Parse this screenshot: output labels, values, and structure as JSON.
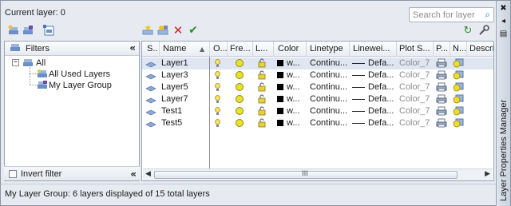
{
  "window": {
    "title": "Layer Properties Manager"
  },
  "current_layer": "Current layer: 0",
  "search": {
    "placeholder": "Search for layer"
  },
  "filters": {
    "header": "Filters",
    "tree": [
      {
        "label": "All"
      },
      {
        "label": "All Used Layers"
      },
      {
        "label": "My Layer Group"
      }
    ],
    "invert_label": "Invert filter"
  },
  "grid": {
    "columns": [
      "S..",
      "Name",
      "O...",
      "Fre...",
      "L...",
      "Color",
      "Linetype",
      "Linewei...",
      "Plot S...",
      "P...",
      "N...",
      "Descrip"
    ],
    "rows": [
      {
        "name": "Layer1",
        "color": "w...",
        "linetype": "Continu...",
        "lineweight": "Defa...",
        "plot_style": "Color_7"
      },
      {
        "name": "Layer3",
        "color": "w...",
        "linetype": "Continu...",
        "lineweight": "Defa...",
        "plot_style": "Color_7"
      },
      {
        "name": "Layer5",
        "color": "w...",
        "linetype": "Continu...",
        "lineweight": "Defa...",
        "plot_style": "Color_7"
      },
      {
        "name": "Layer7",
        "color": "w...",
        "linetype": "Continu...",
        "lineweight": "Defa...",
        "plot_style": "Color_7"
      },
      {
        "name": "Test1",
        "color": "w...",
        "linetype": "Continu...",
        "lineweight": "Defa...",
        "plot_style": "Color_7"
      },
      {
        "name": "Test5",
        "color": "w...",
        "linetype": "Continu...",
        "lineweight": "Defa...",
        "plot_style": "Color_7"
      }
    ],
    "scroll_grip": "III"
  },
  "status": "My Layer Group: 6 layers displayed of 15 total layers",
  "icons": {
    "collapse": "«",
    "expand_tree": "−",
    "titlebar_close": "✖",
    "titlebar_autohide": "◂",
    "titlebar_props": "▤",
    "refresh": "↻",
    "settings": "🔧"
  },
  "colors": {
    "accent": "#2b6fc0",
    "selected_row": "#dfe6f1",
    "on_bulb": "#e8e22a",
    "delete_red": "#c62828",
    "check_green": "#2e8b2e"
  }
}
